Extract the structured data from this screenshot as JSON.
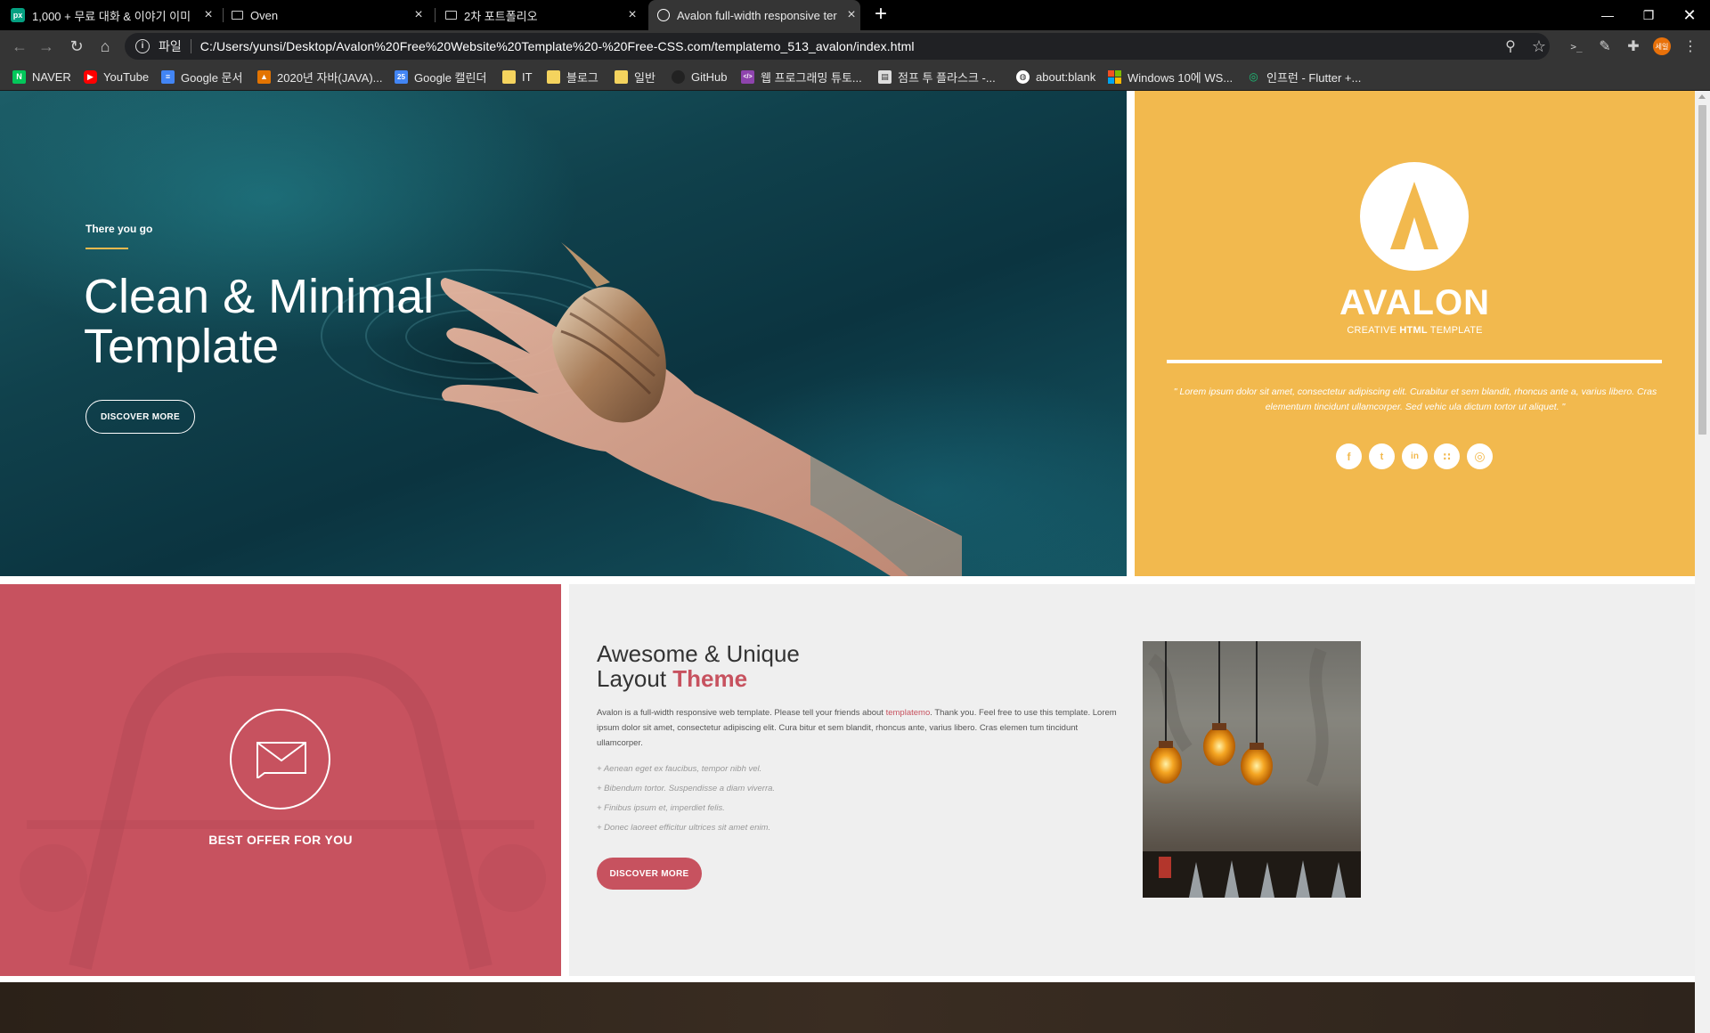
{
  "browser": {
    "tabs": [
      {
        "label": "1,000 + 무료 대화 & 이야기 이미",
        "favicon": "px-icon"
      },
      {
        "label": "Oven",
        "favicon": "page-icon"
      },
      {
        "label": "2차 포트폴리오",
        "favicon": "page-icon"
      },
      {
        "label": "Avalon full-width responsive ter",
        "favicon": "globe-icon"
      }
    ],
    "address": {
      "scheme": "파일",
      "url": "C:/Users/yunsi/Desktop/Avalon%20Free%20Website%20Template%20-%20Free-CSS.com/templatemo_513_avalon/index.html"
    },
    "profile_label": "세일",
    "bookmarks": [
      {
        "label": "NAVER",
        "icon": "naver-icon",
        "color": "#03c75a"
      },
      {
        "label": "YouTube",
        "icon": "youtube-icon",
        "color": "#ff0000"
      },
      {
        "label": "Google 문서",
        "icon": "docs-icon",
        "color": "#4285f4"
      },
      {
        "label": "2020년 자바(JAVA)...",
        "icon": "course-icon",
        "color": "#e37400"
      },
      {
        "label": "Google 캘린더",
        "icon": "calendar-icon",
        "color": "#4285f4"
      },
      {
        "label": "IT",
        "icon": "folder-icon",
        "color": "#f4d35e"
      },
      {
        "label": "블로그",
        "icon": "folder-icon",
        "color": "#f4d35e"
      },
      {
        "label": "일반",
        "icon": "folder-icon",
        "color": "#f4d35e"
      },
      {
        "label": "GitHub",
        "icon": "github-icon",
        "color": "#222222"
      },
      {
        "label": "웹 프로그래밍 튜토...",
        "icon": "code-icon",
        "color": "#8e44ad"
      },
      {
        "label": "점프 투 플라스크 -...",
        "icon": "book-icon",
        "color": "#dddddd"
      },
      {
        "label": "about:blank",
        "icon": "globe-icon",
        "color": "#ffffff"
      },
      {
        "label": "Windows 10에 WS...",
        "icon": "windows-icon",
        "color": "#00a4ef"
      },
      {
        "label": "인프런 - Flutter +...",
        "icon": "inflearn-icon",
        "color": "#1dc078"
      }
    ]
  },
  "hero": {
    "kicker": "There you go",
    "title": "Clean & Minimal Template",
    "button": "DISCOVER MORE"
  },
  "brand": {
    "logo_letter": "Λ",
    "name": "AVALON",
    "sub_pre": "CREATIVE ",
    "sub_bold": "HTML",
    "sub_post": " TEMPLATE",
    "quote": "\" Lorem ipsum dolor sit amet, consectetur adipiscing elit. Curabitur et sem blandit, rhoncus ante a, varius libero. Cras elementum tincidunt ullamcorper. Sed vehic ula dictum tortor ut aliquet. \"",
    "social": [
      {
        "name": "facebook-icon",
        "glyph": "f"
      },
      {
        "name": "twitter-icon",
        "glyph": "t"
      },
      {
        "name": "linkedin-icon",
        "glyph": "in"
      },
      {
        "name": "rss-icon",
        "glyph": "∷"
      },
      {
        "name": "dribbble-icon",
        "glyph": "◎"
      }
    ],
    "color": "#f2b94e"
  },
  "offer": {
    "title": "BEST OFFER FOR YOU",
    "color": "#c7525f"
  },
  "about": {
    "heading_line1": "Awesome & Unique",
    "heading_line2_plain": "Layout ",
    "heading_line2_bold": "Theme",
    "paragraph_pre": "Avalon is a full-width responsive web template. Please tell your friends about ",
    "paragraph_link": "templatemo",
    "paragraph_post": ". Thank you. Feel free to use this template. Lorem ipsum dolor sit amet, consectetur adipiscing elit. Cura bitur et sem blandit, rhoncus ante, varius libero. Cras elemen tum tincidunt ullamcorper.",
    "bullets": [
      "+ Aenean eget ex faucibus, tempor nibh vel.",
      "+ Bibendum tortor. Suspendisse a diam viverra.",
      "+ Finibus ipsum et, imperdiet felis.",
      "+ Donec laoreet efficitur ultrices sit amet enim."
    ],
    "button": "DISCOVER MORE"
  }
}
